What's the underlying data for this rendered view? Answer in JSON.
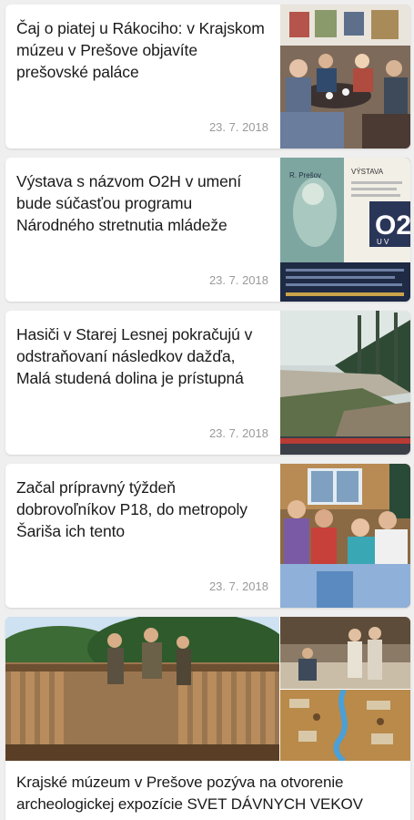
{
  "articles": [
    {
      "title": "Čaj o piatej u Rákociho: v Krajskom múzeu v Prešove objavíte prešovské paláce",
      "date": "23. 7. 2018",
      "image": "museum-lecture-photo"
    },
    {
      "title": "Výstava s názvom O2H v umení bude súčasťou programu Národného stretnutia mládeže",
      "date": "23. 7. 2018",
      "image": "exhibition-poster",
      "poster_text": {
        "top": "VÝSTAVA",
        "sub": "R. Prešov",
        "big": "O2",
        "small": "U V"
      }
    },
    {
      "title": "Hasiči v Starej Lesnej pokračujú v odstraňovaní následkov dažďa, Malá studená dolina je prístupná",
      "date": "23. 7. 2018",
      "image": "flood-river-photo"
    },
    {
      "title": "Začal prípravný týždeň dobrovoľníkov P18, do metropoly Šariša ich tento",
      "date": "23. 7. 2018",
      "image": "volunteers-group-photo"
    },
    {
      "title": "Krajské múzeum v Prešove pozýva na otvorenie archeologickej expozície SVET DÁVNYCH VEKOV",
      "image": "archeological-exposition-collage"
    }
  ]
}
